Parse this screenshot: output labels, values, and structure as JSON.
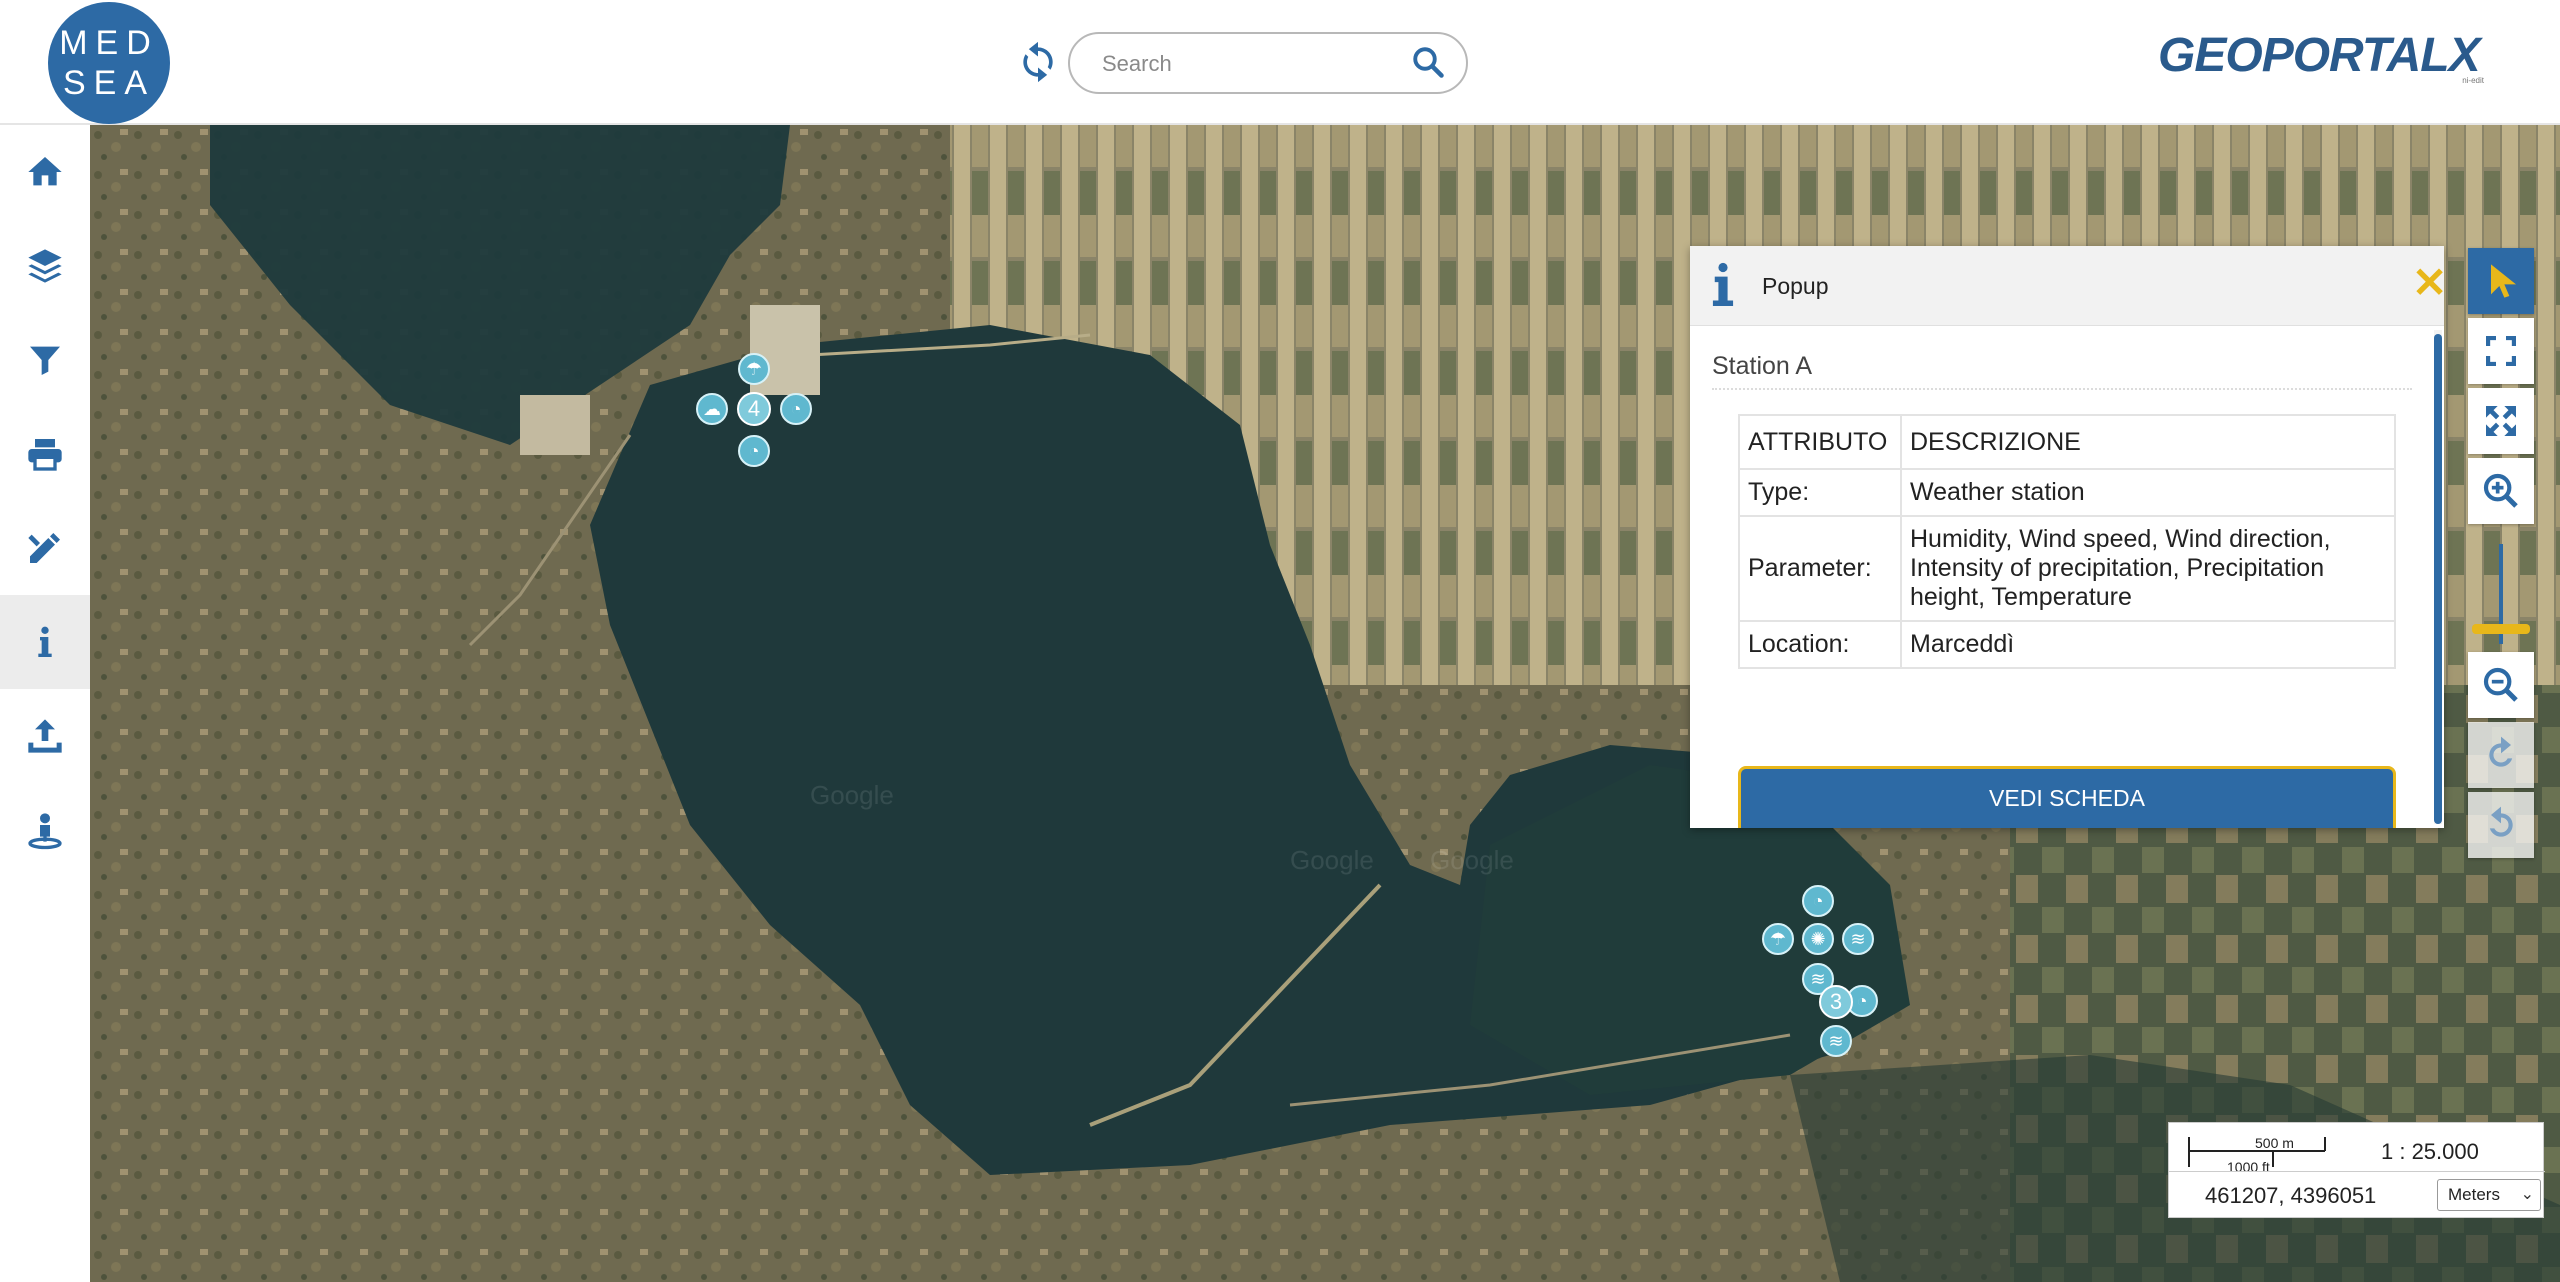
{
  "header": {
    "logo_line1": "MED",
    "logo_line2": "SEA",
    "search_placeholder": "Search",
    "brand_logo_text": "GEOPORTALX",
    "brand_logo_sub": "ni-edit"
  },
  "sidebar": {
    "items": [
      {
        "icon": "home-icon"
      },
      {
        "icon": "layers-icon"
      },
      {
        "icon": "filter-icon"
      },
      {
        "icon": "print-icon"
      },
      {
        "icon": "draw-tools-icon"
      },
      {
        "icon": "info-icon",
        "active": true
      },
      {
        "icon": "upload-icon"
      },
      {
        "icon": "person-location-icon"
      }
    ]
  },
  "map": {
    "watermarks": [
      "Google",
      "Google",
      "Google"
    ],
    "clusters": [
      {
        "count": "4"
      },
      {
        "count": "3"
      }
    ]
  },
  "popup": {
    "title": "Popup",
    "station_name": "Station A",
    "table": {
      "headers": [
        "ATTRIBUTO",
        "DESCRIZIONE"
      ],
      "rows": [
        {
          "attr": "Type:",
          "desc": "Weather station"
        },
        {
          "attr": "Parameter:",
          "desc": "Humidity, Wind speed, Wind direction, Intensity of precipitation, Precipitation height, Temperature"
        },
        {
          "attr": "Location:",
          "desc": "Marceddì"
        }
      ]
    },
    "button_label": "VEDI SCHEDA"
  },
  "toolbar": {
    "buttons": [
      "pointer-icon",
      "fullscreen-icon",
      "zoom-extent-icon",
      "zoom-in-icon",
      "zoom-out-icon",
      "undo-icon",
      "redo-icon"
    ]
  },
  "scale": {
    "metric": "500 m",
    "imperial": "1000 ft",
    "ratio": "1 : 25.000",
    "coords": "461207, 4396051",
    "units": "Meters"
  },
  "colors": {
    "brand_blue": "#2d6aa5",
    "accent_yellow": "#e8b71a",
    "marker_cyan": "#5fb8cf"
  }
}
